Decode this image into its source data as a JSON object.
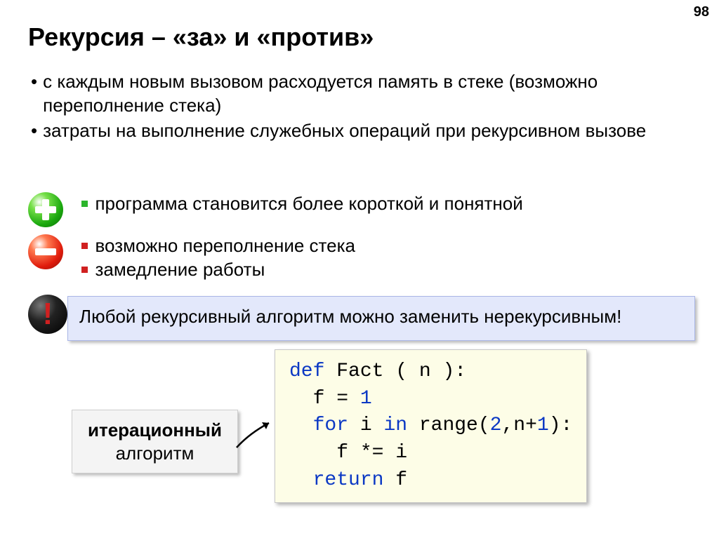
{
  "page_number": "98",
  "title": "Рекурсия – «за» и «против»",
  "bullets": [
    "с каждым новым вызовом расходуется память в стеке (возможно переполнение стека)",
    "затраты на выполнение служебных операций при рекурсивном вызове"
  ],
  "pros": [
    "программа становится более короткой и понятной"
  ],
  "cons": [
    "возможно переполнение стека",
    "замедление работы"
  ],
  "note": "Любой рекурсивный алгоритм можно заменить нерекурсивным!",
  "excl": "!",
  "label": {
    "bold": "итерационный",
    "plain": "алгоритм"
  },
  "code": {
    "l1a": "def",
    "l1b": " Fact ( n ):",
    "l2a": "  f",
    "l2b": " = ",
    "l2c": "1",
    "l3a": "  for",
    "l3b": " i ",
    "l3c": "in",
    "l3d": " range(",
    "l3e": "2",
    "l3f": ",n+",
    "l3g": "1",
    "l3h": "):",
    "l4a": "    f",
    "l4b": " *= ",
    "l4c": "i",
    "l5a": "  return",
    "l5b": " f"
  }
}
